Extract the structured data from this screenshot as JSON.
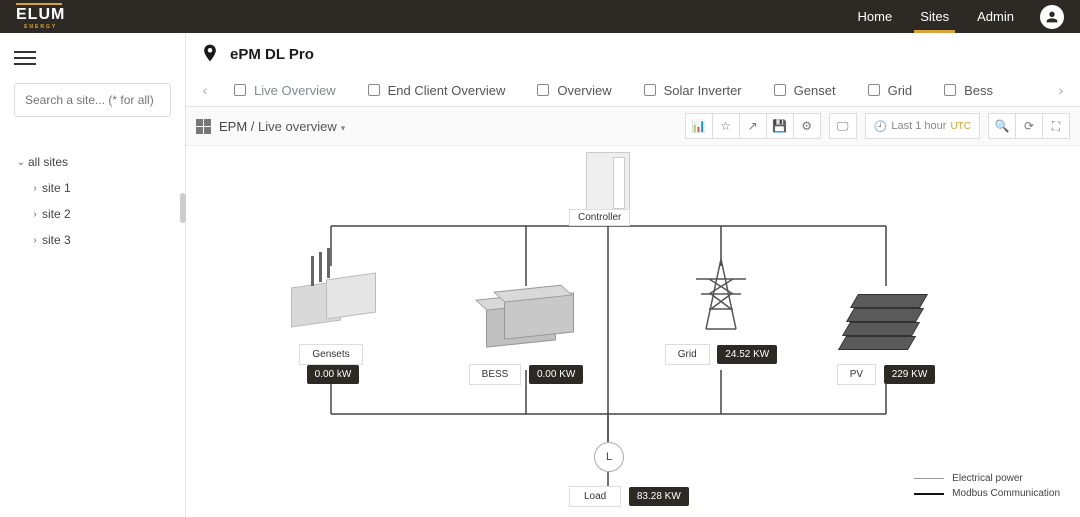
{
  "brand": {
    "name": "ELUM",
    "sub": "ENERGY"
  },
  "nav": {
    "home": "Home",
    "sites": "Sites",
    "admin": "Admin"
  },
  "sidebar": {
    "search_placeholder": "Search a site... (* for all)",
    "all": "all sites",
    "items": [
      "site 1",
      "site 2",
      "site 3"
    ]
  },
  "page": {
    "title": "ePM DL Pro"
  },
  "tabs": [
    "Live Overview",
    "End Client Overview",
    "Overview",
    "Solar Inverter",
    "Genset",
    "Grid",
    "Bess"
  ],
  "breadcrumb": {
    "root": "EPM",
    "current": "Live overview"
  },
  "toolbar": {
    "range": "Last 1 hour",
    "utc": "UTC"
  },
  "diagram": {
    "controller": "Controller",
    "assets": {
      "gensets": {
        "label": "Gensets",
        "value": "0.00 kW"
      },
      "bess": {
        "label": "BESS",
        "value": "0.00 KW"
      },
      "grid": {
        "label": "Grid",
        "value": "24.52 KW"
      },
      "pv": {
        "label": "PV",
        "value": "229 KW"
      }
    },
    "load": {
      "symbol": "L",
      "label": "Load",
      "value": "83.28 KW"
    },
    "legend": {
      "elec": "Electrical power",
      "modbus": "Modbus Communication"
    }
  }
}
